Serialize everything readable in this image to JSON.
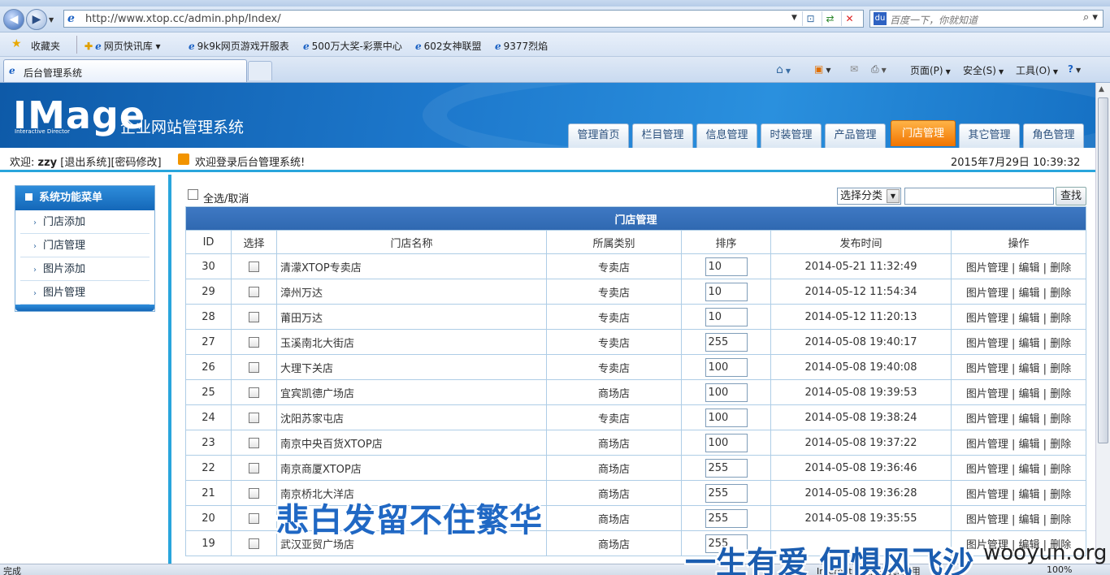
{
  "browser": {
    "title": "后台管理系统",
    "url": "http://www.xtop.cc/admin.php/Index/",
    "search_placeholder": "百度一下，你就知道",
    "favorites_label": "收藏夹",
    "favorites": [
      "网页快讯库 ▾",
      "9k9k网页游戏开服表",
      "500万大奖-彩票中心",
      "602女神联盟",
      "9377烈焰"
    ],
    "tab_title": "后台管理系统",
    "commands": [
      "页面(P)",
      "安全(S)",
      "工具(O)"
    ],
    "status_left": "完成",
    "status_zone": "Internet | 保护模式: 禁用",
    "status_zoom": "100%"
  },
  "header": {
    "logo": "IMage",
    "logo_sub": "Interactive Director",
    "site_name": "企业网站管理系统",
    "nav": [
      "管理首页",
      "栏目管理",
      "信息管理",
      "时装管理",
      "产品管理",
      "门店管理",
      "其它管理",
      "角色管理"
    ],
    "active_nav": "门店管理"
  },
  "infobar": {
    "welcome": "欢迎:",
    "user": "zzy",
    "logout": "[退出系统]",
    "password": "[密码修改]",
    "message": "欢迎登录后台管理系统!",
    "date": "2015年7月29日 10:39:32"
  },
  "sidebar": {
    "title": "系统功能菜单",
    "items": [
      "门店添加",
      "门店管理",
      "图片添加",
      "图片管理"
    ]
  },
  "toolbar": {
    "select_all": "全选/取消",
    "category_select": "选择分类",
    "search_button": "查找"
  },
  "table": {
    "caption": "门店管理",
    "columns": [
      "ID",
      "选择",
      "门店名称",
      "所属类别",
      "排序",
      "发布时间",
      "操作"
    ],
    "ops": [
      "图片管理",
      "编辑",
      "删除"
    ],
    "rows": [
      {
        "id": "30",
        "name": "清濛XTOP专卖店",
        "type": "专卖店",
        "order": "10",
        "time": "2014-05-21 11:32:49"
      },
      {
        "id": "29",
        "name": "漳州万达",
        "type": "专卖店",
        "order": "10",
        "time": "2014-05-12 11:54:34"
      },
      {
        "id": "28",
        "name": "莆田万达",
        "type": "专卖店",
        "order": "10",
        "time": "2014-05-12 11:20:13"
      },
      {
        "id": "27",
        "name": "玉溪南北大街店",
        "type": "专卖店",
        "order": "255",
        "time": "2014-05-08 19:40:17"
      },
      {
        "id": "26",
        "name": "大理下关店",
        "type": "专卖店",
        "order": "100",
        "time": "2014-05-08 19:40:08"
      },
      {
        "id": "25",
        "name": "宜宾凯德广场店",
        "type": "商场店",
        "order": "100",
        "time": "2014-05-08 19:39:53"
      },
      {
        "id": "24",
        "name": "沈阳苏家屯店",
        "type": "专卖店",
        "order": "100",
        "time": "2014-05-08 19:38:24"
      },
      {
        "id": "23",
        "name": "南京中央百货XTOP店",
        "type": "商场店",
        "order": "100",
        "time": "2014-05-08 19:37:22"
      },
      {
        "id": "22",
        "name": "南京商厦XTOP店",
        "type": "商场店",
        "order": "255",
        "time": "2014-05-08 19:36:46"
      },
      {
        "id": "21",
        "name": "南京桥北大洋店",
        "type": "商场店",
        "order": "255",
        "time": "2014-05-08 19:36:28"
      },
      {
        "id": "20",
        "name": "",
        "type": "商场店",
        "order": "255",
        "time": "2014-05-08 19:35:55"
      },
      {
        "id": "19",
        "name": "武汉亚贸广场店",
        "type": "商场店",
        "order": "255",
        "time": ""
      }
    ]
  },
  "watermarks": {
    "line1": "悲白发留不住繁华",
    "line2": "一生有爱 何惧风飞沙",
    "site": "wooyun.org"
  }
}
